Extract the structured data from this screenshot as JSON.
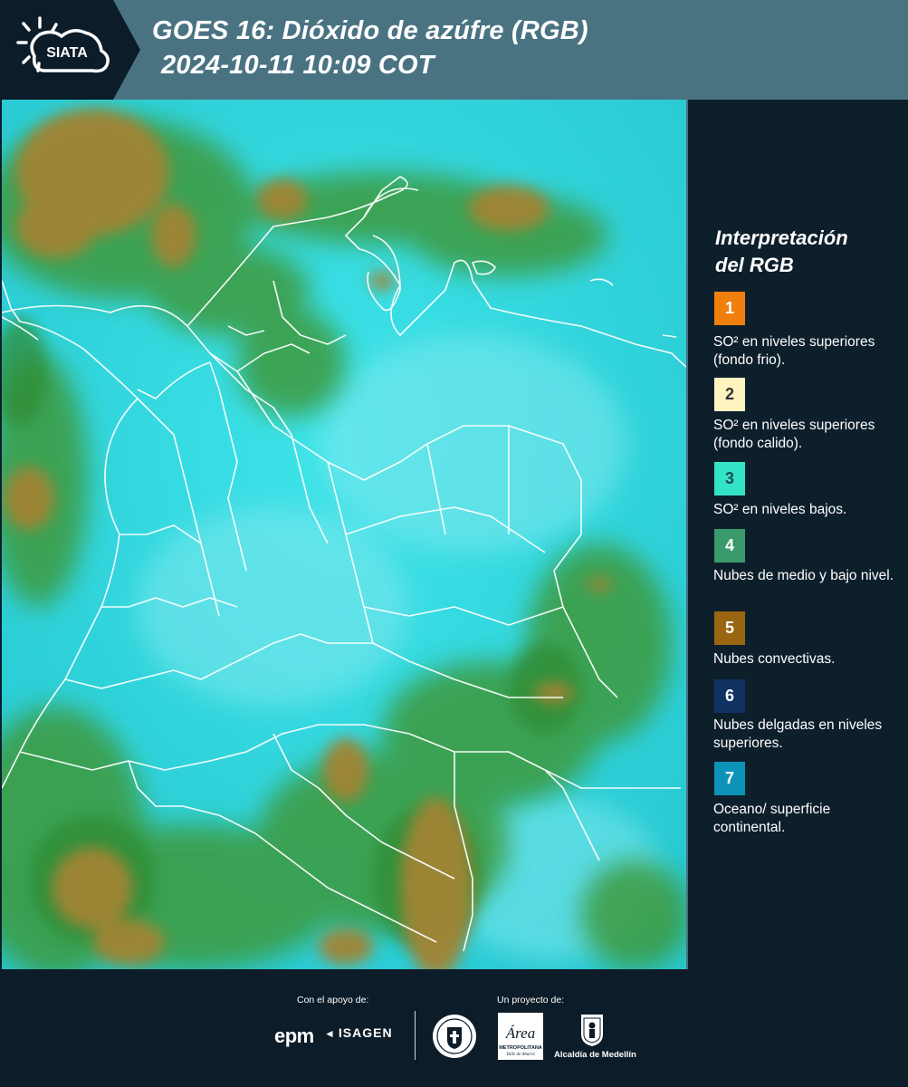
{
  "header": {
    "logo_text": "SIATA",
    "title_line1": "GOES 16: Dióxido de azúfre (RGB)",
    "title_line2": "2024-10-11 10:09 COT"
  },
  "map": {
    "product": "GOES 16 SO2 RGB composite",
    "icons": [
      "country-boundaries",
      "department-boundaries"
    ],
    "colors": {
      "background_surface": "#33d6dc",
      "low_mid_cloud": "#3a9a3c",
      "convective_cloud": "#9a8031",
      "boundary_lines": "#ffffff"
    }
  },
  "legend": {
    "heading_line1": "Interpretación",
    "heading_line2": "del RGB",
    "items": [
      {
        "number": "1",
        "color": "#f07f0d",
        "text_color": "#ffffff",
        "label": "SO² en niveles superiores (fondo frio)."
      },
      {
        "number": "2",
        "color": "#fff3c0",
        "text_color": "#333333",
        "label": "SO² en niveles superiores (fondo calido)."
      },
      {
        "number": "3",
        "color": "#33e3c6",
        "text_color": "#1c4b55",
        "label": "SO² en niveles bajos."
      },
      {
        "number": "4",
        "color": "#3b9a6b",
        "text_color": "#ffffff",
        "label": "Nubes de medio y bajo nivel."
      },
      {
        "number": "5",
        "color": "#9a6510",
        "text_color": "#ffffff",
        "label": "Nubes convectivas."
      },
      {
        "number": "6",
        "color": "#0f3263",
        "text_color": "#ffffff",
        "label": "Nubes delgadas en niveles superiores."
      },
      {
        "number": "7",
        "color": "#0e93b8",
        "text_color": "#ffffff",
        "label": "Oceano/ superficie continental."
      }
    ]
  },
  "footer": {
    "support_label": "Con el apoyo de:",
    "project_label": "Un proyecto de:",
    "epm": "epm",
    "isagen": "ISAGEN",
    "area_name": "Área",
    "area_sub": "METROPOLITANA",
    "area_sub2": "Valle de Aburrá",
    "alcaldia": "Alcaldía de Medellín"
  }
}
